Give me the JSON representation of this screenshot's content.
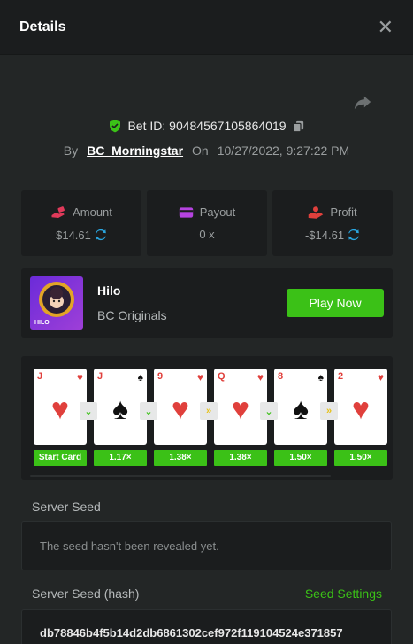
{
  "header": {
    "title": "Details"
  },
  "bet": {
    "id_label": "Bet ID: 90484567105864019",
    "by_label": "By",
    "username": "BC_Morningstar",
    "on_label": "On",
    "datetime": "10/27/2022, 9:27:22 PM"
  },
  "stats": {
    "amount": {
      "label": "Amount",
      "value": "$14.61"
    },
    "payout": {
      "label": "Payout",
      "value": "0 x"
    },
    "profit": {
      "label": "Profit",
      "value": "-$14.61"
    }
  },
  "game": {
    "name": "Hilo",
    "provider": "BC Originals",
    "thumb_label": "HILO",
    "play_label": "Play Now"
  },
  "cards": [
    {
      "rank": "J",
      "suit": "♥",
      "color": "#e0403c",
      "multiplier": "Start Card"
    },
    {
      "rank": "J",
      "suit": "♠",
      "color": "#111111",
      "multiplier": "1.17×"
    },
    {
      "rank": "9",
      "suit": "♥",
      "color": "#e0403c",
      "multiplier": "1.38×"
    },
    {
      "rank": "Q",
      "suit": "♥",
      "color": "#e0403c",
      "multiplier": "1.38×"
    },
    {
      "rank": "8",
      "suit": "♠",
      "color": "#111111",
      "multiplier": "1.50×"
    },
    {
      "rank": "2",
      "suit": "♥",
      "color": "#e0403c",
      "multiplier": "1.50×"
    }
  ],
  "arrows": [
    {
      "symbol": "⌄",
      "color": "#3bc117"
    },
    {
      "symbol": "⌄",
      "color": "#3bc117"
    },
    {
      "symbol": "»",
      "color": "#e6c21a"
    },
    {
      "symbol": "⌄",
      "color": "#3bc117"
    },
    {
      "symbol": "»",
      "color": "#e6c21a"
    }
  ],
  "server_seed": {
    "label": "Server Seed",
    "text": "The seed hasn't been revealed yet."
  },
  "server_seed_hash": {
    "label": "Server Seed (hash)",
    "settings_label": "Seed Settings",
    "value": "db78846b4f5b14d2db6861302cef972f119104524e371857"
  },
  "colors": {
    "accent": "#3bc117",
    "background": "#232626",
    "panel": "#1b1d1e"
  }
}
